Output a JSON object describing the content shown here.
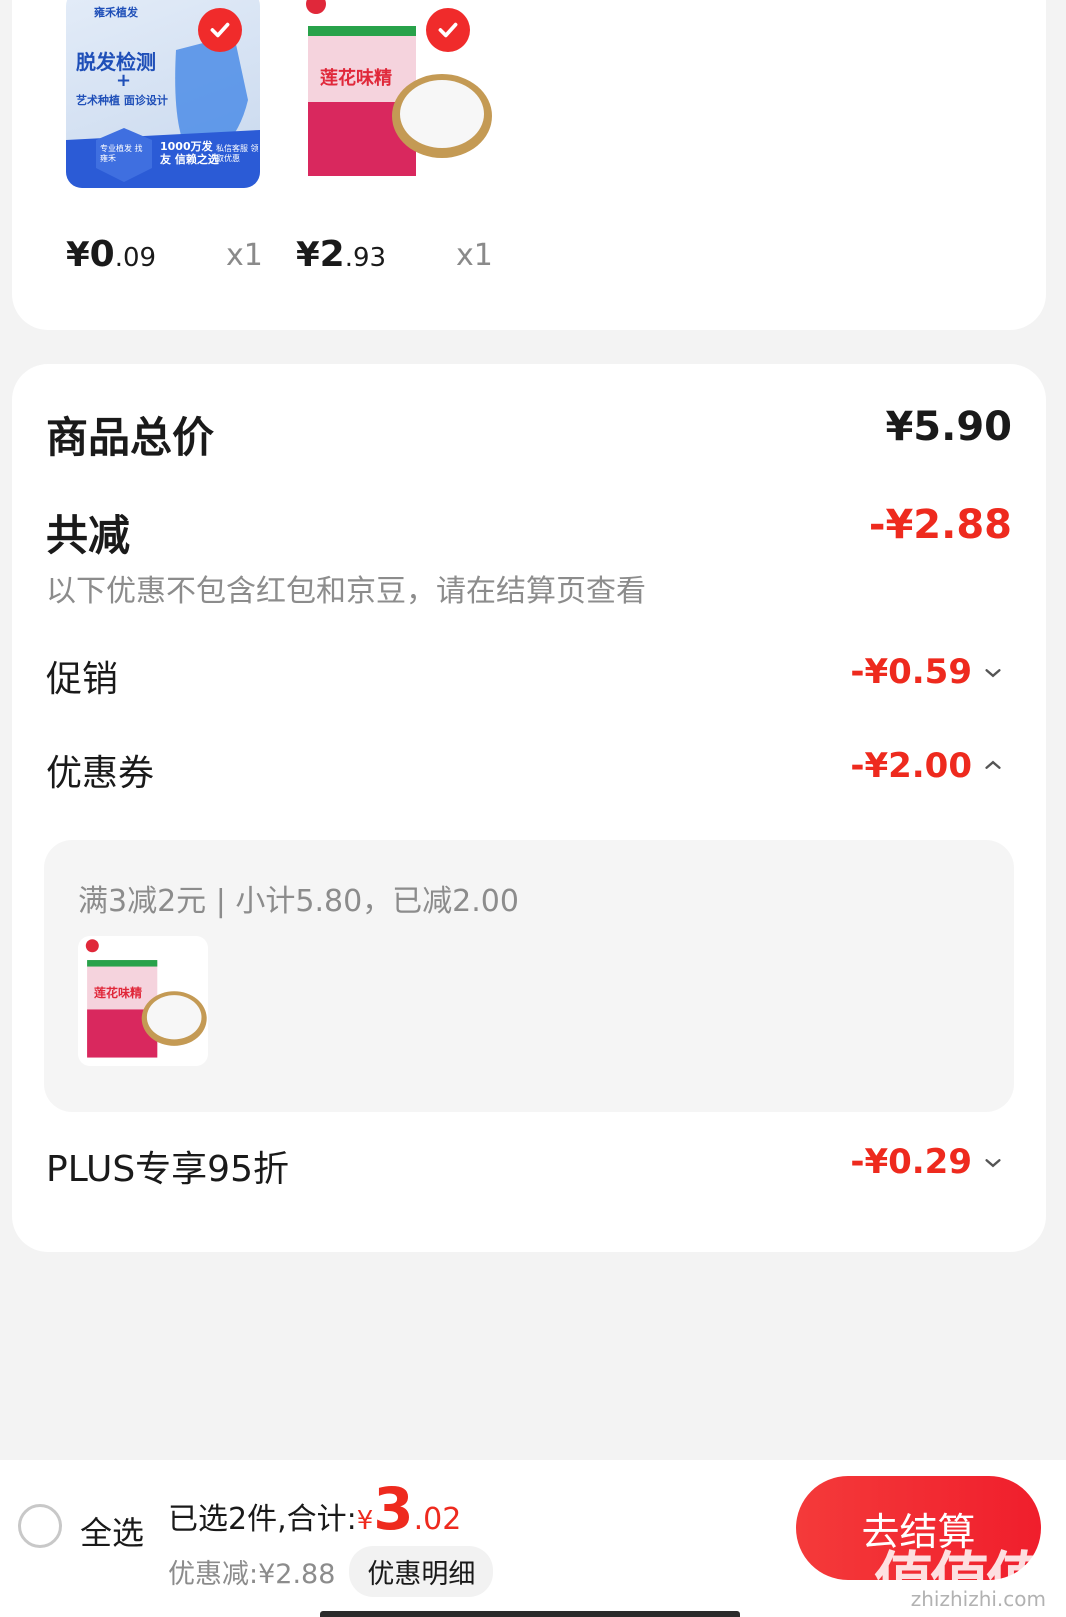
{
  "products": [
    {
      "price_currency": "¥",
      "price_int": "0",
      "price_dec": ".09",
      "qty": "x1",
      "image_text": {
        "brand": "雍禾植发",
        "headline": "脱发检测",
        "plus": "+",
        "sub": "艺术种植 面诊设计",
        "badge1": "专业植发 找雍禾",
        "badge2": "1000万发友 信赖之选",
        "badge3": "私信客服 领取优惠"
      }
    },
    {
      "price_currency": "¥",
      "price_int": "2",
      "price_dec": ".93",
      "qty": "x1",
      "image_text": {
        "brand": "莲花味精"
      }
    }
  ],
  "summary": {
    "total_label": "商品总价",
    "total_value": "¥5.90",
    "reduce_label": "共减",
    "reduce_value": "-¥2.88",
    "note": "以下优惠不包含红包和京豆，请在结算页查看",
    "promo_label": "促销",
    "promo_value": "-¥0.59",
    "coupon_label": "优惠券",
    "coupon_value": "-¥2.00",
    "coupon_detail": "满3减2元 | 小计5.80，已减2.00",
    "plus_label": "PLUS专享95折",
    "plus_value": "-¥0.29"
  },
  "bottom": {
    "select_all": "全选",
    "selected_text": "已选2件,合计:",
    "total_currency": "¥",
    "total_int": "3",
    "total_dec": ".02",
    "discount_text": "优惠减:¥2.88",
    "detail_button": "优惠明细",
    "checkout_button": "去结算",
    "watermark": "值值值",
    "watermark_site": "zhizhizhi.com"
  },
  "colors": {
    "accent_red": "#ee2a1e",
    "checkout": "#f02b2b"
  }
}
